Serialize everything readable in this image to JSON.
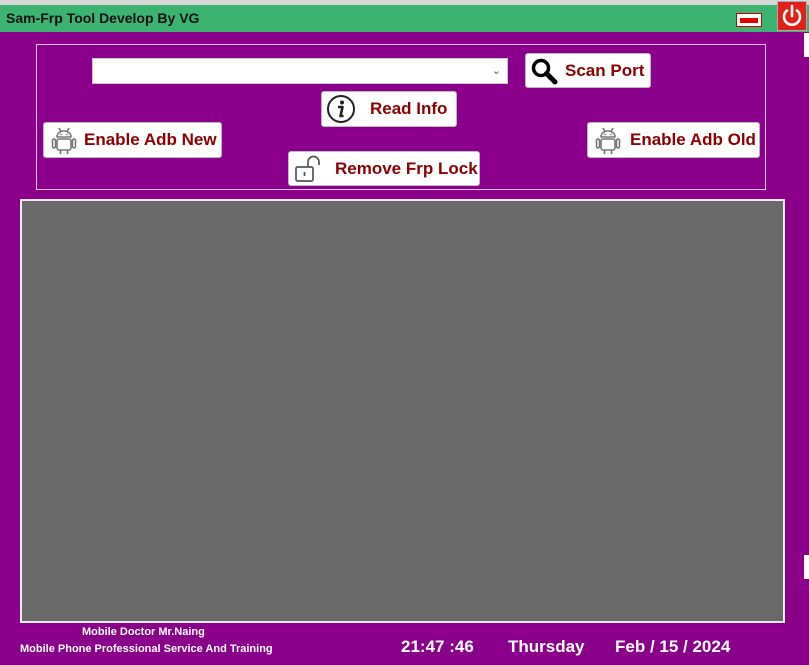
{
  "window": {
    "title": "Sam-Frp Tool Develop By VG"
  },
  "toolbar": {
    "port_select_value": "",
    "scan_port_label": "Scan Port",
    "read_info_label": "Read Info",
    "enable_adb_new_label": "Enable Adb New",
    "enable_adb_old_label": "Enable Adb Old",
    "remove_frp_lock_label": "Remove Frp Lock"
  },
  "icons": {
    "scan": "magnifier-icon",
    "info": "info-icon",
    "adb_new": "android-icon",
    "adb_old": "android-icon",
    "frp": "unlock-icon",
    "minimize": "minimize-icon",
    "power": "power-icon"
  },
  "log": {
    "text": ""
  },
  "footer": {
    "author": "Mobile Doctor Mr.Naing",
    "tagline": "Mobile Phone Professional Service And Training",
    "time": "21:47 :46",
    "weekday": "Thursday",
    "date": "Feb / 15 / 2024"
  },
  "colors": {
    "background": "#8b008b",
    "titlebar": "#3cb371",
    "button_text": "#8b0000",
    "log_background": "#696969",
    "close_button": "#e0201a"
  }
}
